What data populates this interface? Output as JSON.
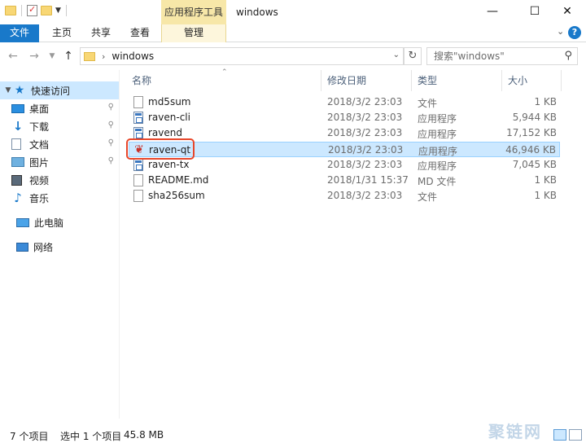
{
  "window": {
    "title": "windows",
    "contextual_tab_header": "应用程序工具"
  },
  "ribbon": {
    "tabs": [
      "文件",
      "主页",
      "共享",
      "查看",
      "管理"
    ]
  },
  "address": {
    "path": "windows",
    "search_placeholder": "搜索\"windows\""
  },
  "nav": {
    "quick_access": "快速访问",
    "items": [
      "桌面",
      "下载",
      "文档",
      "图片",
      "视频",
      "音乐"
    ],
    "this_pc": "此电脑",
    "network": "网络"
  },
  "columns": {
    "name": "名称",
    "date": "修改日期",
    "type": "类型",
    "size": "大小"
  },
  "files": [
    {
      "name": "md5sum",
      "date": "2018/3/2 23:03",
      "type": "文件",
      "size": "1 KB",
      "icon": "file-icon"
    },
    {
      "name": "raven-cli",
      "date": "2018/3/2 23:03",
      "type": "应用程序",
      "size": "5,944 KB",
      "icon": "exe-icon"
    },
    {
      "name": "ravend",
      "date": "2018/3/2 23:03",
      "type": "应用程序",
      "size": "17,152 KB",
      "icon": "exe-icon"
    },
    {
      "name": "raven-qt",
      "date": "2018/3/2 23:03",
      "type": "应用程序",
      "size": "46,946 KB",
      "icon": "raven-icon",
      "selected": true
    },
    {
      "name": "raven-tx",
      "date": "2018/3/2 23:03",
      "type": "应用程序",
      "size": "7,045 KB",
      "icon": "exe-icon"
    },
    {
      "name": "README.md",
      "date": "2018/1/31 15:37",
      "type": "MD 文件",
      "size": "1 KB",
      "icon": "file-icon"
    },
    {
      "name": "sha256sum",
      "date": "2018/3/2 23:03",
      "type": "文件",
      "size": "1 KB",
      "icon": "file-icon"
    }
  ],
  "status": {
    "count": "7 个项目",
    "selected": "选中 1 个项目",
    "size": "45.8 MB"
  },
  "watermark": "聚链网",
  "colors": {
    "accent": "#1979ca",
    "selection": "#cce8ff",
    "highlight_ring": "#e8462a"
  }
}
